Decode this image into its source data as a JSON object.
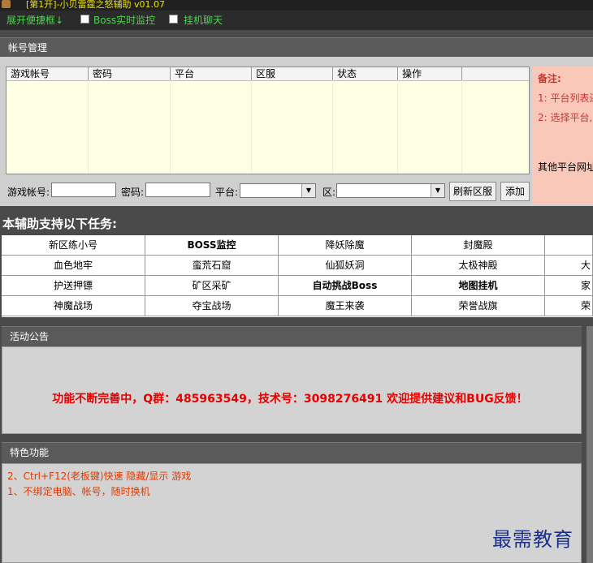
{
  "window": {
    "title": "[第1开]-小贝雷霆之怒辅助 v01.07"
  },
  "toolbar": {
    "expand_label": "展开便捷框↓",
    "boss_monitor_label": "Boss实时监控",
    "idle_chat_label": "挂机聊天"
  },
  "account_panel": {
    "title": "帐号管理",
    "columns": [
      "游戏帐号",
      "密码",
      "平台",
      "区服",
      "状态",
      "操作"
    ],
    "notes": {
      "heading": "备注:",
      "line1": "1: 平台列表还",
      "line2": "2: 选择平台,",
      "line3": "其他平台网址"
    },
    "form": {
      "account_label": "游戏帐号:",
      "account_value": "",
      "password_label": "密码:",
      "password_value": "",
      "platform_label": "平台:",
      "platform_value": "",
      "server_label": "区:",
      "server_value": "",
      "refresh_button": "刷新区服",
      "add_button": "添加"
    }
  },
  "tasks": {
    "title": "本辅助支持以下任务:",
    "rows": [
      [
        "新区练小号",
        "BOSS监控",
        "降妖除魔",
        "封魔殿",
        ""
      ],
      [
        "血色地牢",
        "蛮荒石窟",
        "仙狐妖洞",
        "太极神殿",
        "大"
      ],
      [
        "护送押镖",
        "矿区采矿",
        "自动挑战Boss",
        "地图挂机",
        "家"
      ],
      [
        "神魔战场",
        "夺宝战场",
        "魔王来袭",
        "荣誉战旗",
        "荣"
      ]
    ]
  },
  "announcement": {
    "title": "活动公告",
    "text": "功能不断完善中，Q群：485963549，技术号：3098276491 欢迎提供建议和BUG反馈！"
  },
  "features": {
    "title": "特色功能",
    "line1": "2、Ctrl+F12(老板键)快速 隐藏/显示 游戏",
    "line2": "1、不绑定电脑、帐号，随时换机"
  },
  "watermark": "最需教育",
  "colors": {
    "toolbar_text": "#49d64a",
    "title_text": "#e8e000",
    "announcement_text": "#e60000",
    "feature_text": "#e03a00",
    "grid_bg": "#ffffe6",
    "notes_bg": "#f9c8b8"
  }
}
